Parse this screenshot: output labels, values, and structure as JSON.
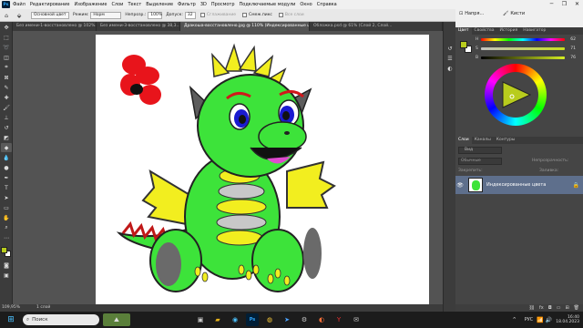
{
  "menubar": {
    "app_logo": "Ps",
    "items": [
      "Файл",
      "Редактирование",
      "Изображение",
      "Слои",
      "Текст",
      "Выделение",
      "Фильтр",
      "3D",
      "Просмотр",
      "Подключаемые модули",
      "Окно",
      "Справка"
    ]
  },
  "window_controls": {
    "minimize": "─",
    "maximize": "❐",
    "close": "✕"
  },
  "options": {
    "preset": "Основной цвет",
    "mode_label": "Режим:",
    "mode_value": "Норм",
    "opacity_label": "Непрозр.:",
    "opacity_value": "100%",
    "tolerance_label": "Допуск:",
    "tolerance_value": "32",
    "antialias_label": "Сглаживание",
    "contiguous_label": "Смеж.пикс",
    "all_layers_label": "Все слои"
  },
  "tabs": [
    "Без имени-1-восстановлено @ 102%...",
    "Без имени-3-восстановлено @ 38,3...",
    "Дракоша-восстановлено.jpg @ 110% (Индексированные цвета)",
    "Обложка.psd @ 61% (Слой 2, Слой..."
  ],
  "status": {
    "zoom": "109,95%",
    "layer_info": "1 слой"
  },
  "topright": {
    "navigator": "Напря...",
    "brushes": "Кисти"
  },
  "color_panel": {
    "tabs": [
      "Цвет",
      "Свойства",
      "История",
      "Навигатор"
    ],
    "sliders": [
      {
        "label": "H",
        "value": "62"
      },
      {
        "label": "S",
        "value": "71"
      },
      {
        "label": "B",
        "value": "76"
      }
    ],
    "foreground": "#b8cc1d",
    "background": "#ffffff"
  },
  "layers_panel": {
    "tabs": [
      "Слои",
      "Каналы",
      "Контуры"
    ],
    "kind_placeholder": "Вид",
    "blend_mode": "Обычные",
    "opacity_label": "Непрозрачность:",
    "lock_label": "Закрепить:",
    "fill_label": "Заливка:",
    "layer_name": "Индексированные цвета"
  },
  "taskbar": {
    "search_placeholder": "Поиск",
    "language": "РУС",
    "time": "16:40",
    "date": "18.04.2023"
  },
  "colors": {
    "ps_blue": "#31a8ff",
    "canvas": "#ffffff",
    "selected_layer": "#5e6f8c"
  }
}
